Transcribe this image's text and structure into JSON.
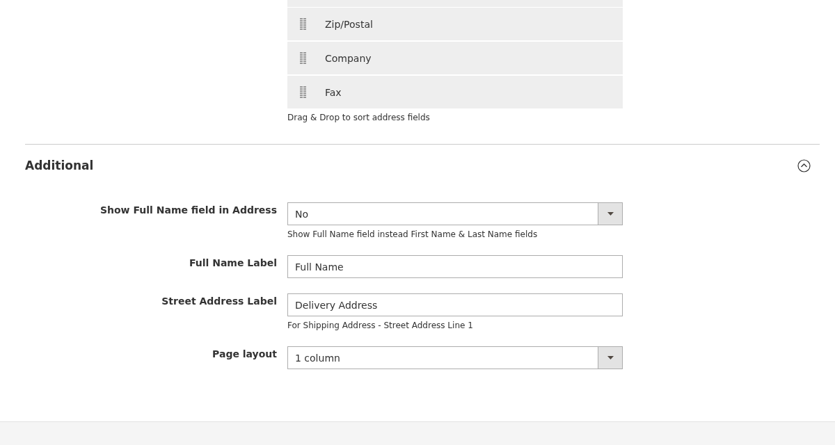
{
  "sortable_fields": [
    {
      "label": "Zip/Postal"
    },
    {
      "label": "Company"
    },
    {
      "label": "Fax"
    }
  ],
  "sortable_note": "Drag & Drop to sort address fields",
  "section": {
    "title": "Additional",
    "expanded": true
  },
  "fields": [
    {
      "kind": "select",
      "label": "Show Full Name field in Address",
      "value": "No",
      "note": "Show Full Name field instead First Name & Last Name fields"
    },
    {
      "kind": "text",
      "label": "Full Name Label",
      "value": "Full Name"
    },
    {
      "kind": "text",
      "label": "Street Address Label",
      "value": "Delivery Address",
      "note": "For Shipping Address - Street Address Line 1"
    },
    {
      "kind": "select",
      "label": "Page layout",
      "value": "1 column"
    }
  ]
}
